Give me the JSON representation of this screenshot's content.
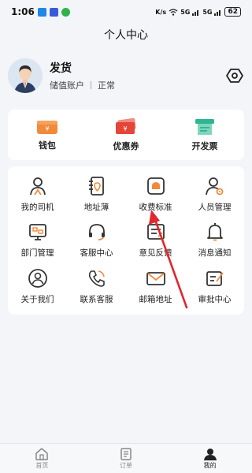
{
  "status": {
    "time": "1:06",
    "network": "K/s",
    "signal1": "5G",
    "signal2": "5G",
    "battery": "62"
  },
  "page_title": "个人中心",
  "profile": {
    "name": "发货",
    "account_type": "储值账户",
    "status": "正常"
  },
  "top_actions": [
    {
      "label": "钱包",
      "icon": "wallet-icon"
    },
    {
      "label": "优惠券",
      "icon": "coupon-icon"
    },
    {
      "label": "开发票",
      "icon": "invoice-icon"
    }
  ],
  "grid": [
    {
      "label": "我的司机",
      "icon": "driver-icon"
    },
    {
      "label": "地址薄",
      "icon": "address-book-icon"
    },
    {
      "label": "收费标准",
      "icon": "fee-standard-icon"
    },
    {
      "label": "人员管理",
      "icon": "staff-management-icon"
    },
    {
      "label": "部门管理",
      "icon": "department-icon"
    },
    {
      "label": "客服中心",
      "icon": "headset-icon"
    },
    {
      "label": "意见反馈",
      "icon": "feedback-icon"
    },
    {
      "label": "消息通知",
      "icon": "bell-icon"
    },
    {
      "label": "关于我们",
      "icon": "about-icon"
    },
    {
      "label": "联系客服",
      "icon": "phone-icon"
    },
    {
      "label": "邮箱地址",
      "icon": "mail-icon"
    },
    {
      "label": "审批中心",
      "icon": "approval-icon"
    }
  ],
  "tabs": [
    {
      "label": "首页",
      "icon": "home-icon"
    },
    {
      "label": "订单",
      "icon": "order-icon"
    },
    {
      "label": "我的",
      "icon": "profile-icon"
    }
  ],
  "colors": {
    "accent_orange": "#f28a3c",
    "coupon_red": "#e4453a",
    "invoice_teal": "#2fb592",
    "icon_dark": "#333333",
    "annotation_arrow": "#e0282e"
  }
}
